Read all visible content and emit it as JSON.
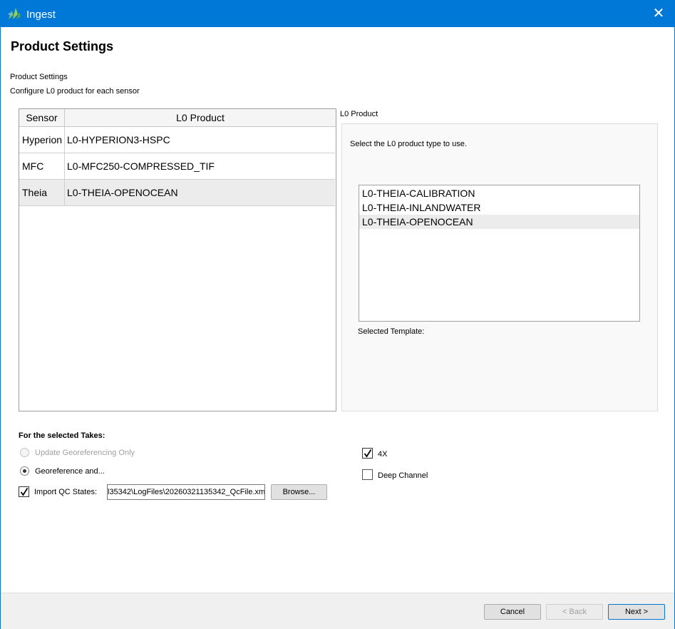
{
  "window": {
    "title": "Ingest",
    "logo_icon": "ingest-logo-icon",
    "close_glyph": "✕",
    "accent_color": "#0078d7"
  },
  "page": {
    "title": "Product Settings",
    "subtitle": "Product Settings",
    "description": "Configure L0 product for each sensor"
  },
  "table": {
    "headers": [
      "Sensor",
      "L0 Product"
    ],
    "rows": [
      {
        "sensor": "Hyperion",
        "product": "L0-HYPERION3-HSPC",
        "selected": false
      },
      {
        "sensor": "MFC",
        "product": "L0-MFC250-COMPRESSED_TIF",
        "selected": false
      },
      {
        "sensor": "Theia",
        "product": "L0-THEIA-OPENOCEAN",
        "selected": true
      }
    ]
  },
  "l0_product": {
    "group_label": "L0 Product",
    "description": "Select the L0 product type to use.",
    "options": [
      "L0-THEIA-CALIBRATION",
      "L0-THEIA-INLANDWATER",
      "L0-THEIA-OPENOCEAN"
    ],
    "selected": "L0-THEIA-OPENOCEAN",
    "template_label": "Selected Template:"
  },
  "takes": {
    "label": "For the selected Takes:",
    "update_georef_label": "Update Georeferencing Only",
    "update_georef_enabled": false,
    "georeference_label": "Georeference and...",
    "georeference_checked": true,
    "import_qc_label": "Import QC States:",
    "import_qc_checked": true,
    "import_qc_path": "l35342\\LogFiles\\20260321135342_QcFile.xml",
    "browse_label": "Browse...",
    "fourx_label": "4X",
    "fourx_checked": true,
    "deep_channel_label": "Deep Channel",
    "deep_channel_checked": false
  },
  "footer": {
    "cancel_label": "Cancel",
    "back_label": "< Back",
    "back_enabled": false,
    "next_label": "Next >"
  }
}
